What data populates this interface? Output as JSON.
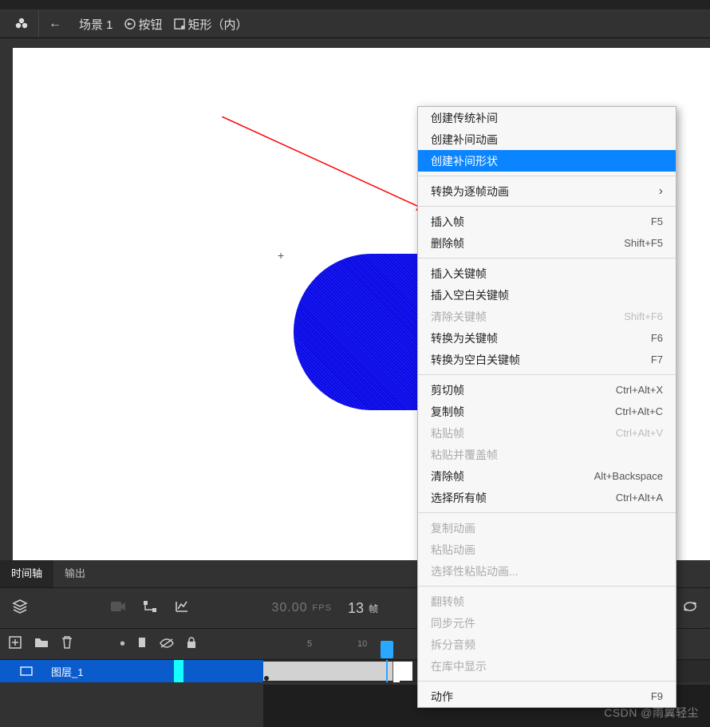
{
  "breadcrumb": {
    "scene": "场景 1",
    "button_symbol": "按钮",
    "shape_symbol": "矩形（内）"
  },
  "stage": {
    "crosshair_glyph": "+"
  },
  "timeline": {
    "tabs": {
      "timeline": "时间轴",
      "output": "输出"
    },
    "fps_value": "30.00",
    "fps_label": "FPS",
    "frame_value": "13",
    "frame_label": "帧",
    "ruler": {
      "t5": "5",
      "t10": "10"
    },
    "layer": {
      "name": "图层_1"
    }
  },
  "context_menu": {
    "items": [
      {
        "label": "创建传统补间",
        "enabled": true
      },
      {
        "label": "创建补间动画",
        "enabled": true
      },
      {
        "label": "创建补间形状",
        "enabled": true,
        "selected": true
      },
      {
        "sep": true
      },
      {
        "label": "转换为逐帧动画",
        "enabled": true,
        "submenu": true
      },
      {
        "sep": true
      },
      {
        "label": "插入帧",
        "shortcut": "F5",
        "enabled": true
      },
      {
        "label": "删除帧",
        "shortcut": "Shift+F5",
        "enabled": true
      },
      {
        "sep": true
      },
      {
        "label": "插入关键帧",
        "enabled": true
      },
      {
        "label": "插入空白关键帧",
        "enabled": true
      },
      {
        "label": "清除关键帧",
        "shortcut": "Shift+F6",
        "enabled": false
      },
      {
        "label": "转换为关键帧",
        "shortcut": "F6",
        "enabled": true
      },
      {
        "label": "转换为空白关键帧",
        "shortcut": "F7",
        "enabled": true
      },
      {
        "sep": true
      },
      {
        "label": "剪切帧",
        "shortcut": "Ctrl+Alt+X",
        "enabled": true
      },
      {
        "label": "复制帧",
        "shortcut": "Ctrl+Alt+C",
        "enabled": true
      },
      {
        "label": "粘贴帧",
        "shortcut": "Ctrl+Alt+V",
        "enabled": false
      },
      {
        "label": "粘贴并覆盖帧",
        "enabled": false
      },
      {
        "label": "清除帧",
        "shortcut": "Alt+Backspace",
        "enabled": true
      },
      {
        "label": "选择所有帧",
        "shortcut": "Ctrl+Alt+A",
        "enabled": true
      },
      {
        "sep": true
      },
      {
        "label": "复制动画",
        "enabled": false
      },
      {
        "label": "粘贴动画",
        "enabled": false
      },
      {
        "label": "选择性粘贴动画...",
        "enabled": false
      },
      {
        "sep": true
      },
      {
        "label": "翻转帧",
        "enabled": false
      },
      {
        "label": "同步元件",
        "enabled": false
      },
      {
        "label": "拆分音频",
        "enabled": false
      },
      {
        "label": "在库中显示",
        "enabled": false
      },
      {
        "sep": true
      },
      {
        "label": "动作",
        "shortcut": "F9",
        "enabled": true
      }
    ]
  },
  "watermark": "CSDN @雨翼轻尘"
}
